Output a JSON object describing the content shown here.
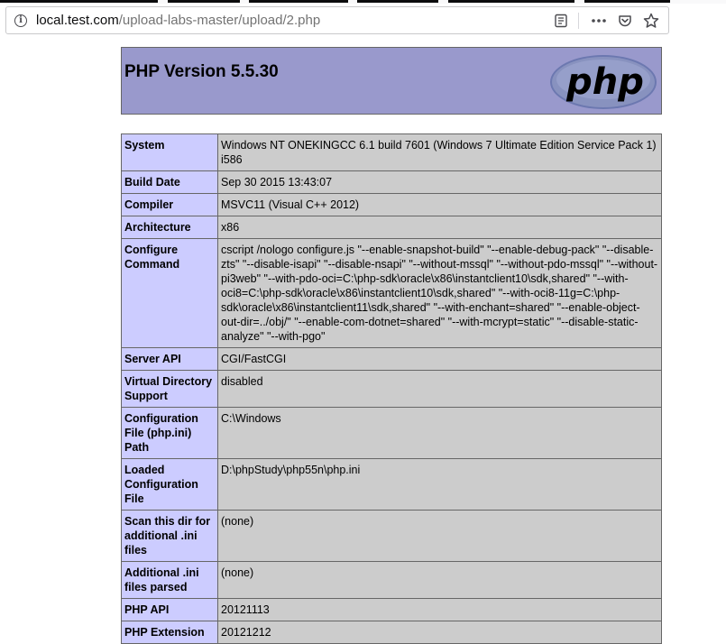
{
  "browser": {
    "url_host": "local.test.com",
    "url_path": "/upload-labs-master/upload/2.php",
    "icons": [
      "info-icon",
      "reader-view-icon",
      "more-icon",
      "pocket-icon",
      "bookmark-star-icon"
    ]
  },
  "header": {
    "title": "PHP Version 5.5.30",
    "logo_text": "php"
  },
  "colors": {
    "header_bg": "#9999cc",
    "label_bg": "#ccccff",
    "value_bg": "#cccccc",
    "border": "#666666"
  },
  "info_rows": [
    {
      "label": "System",
      "value": "Windows NT ONEKINGCC 6.1 build 7601 (Windows 7 Ultimate Edition Service Pack 1) i586"
    },
    {
      "label": "Build Date",
      "value": "Sep 30 2015 13:43:07"
    },
    {
      "label": "Compiler",
      "value": "MSVC11 (Visual C++ 2012)"
    },
    {
      "label": "Architecture",
      "value": "x86"
    },
    {
      "label": "Configure Command",
      "value": "cscript /nologo configure.js \"--enable-snapshot-build\" \"--enable-debug-pack\" \"--disable-zts\" \"--disable-isapi\" \"--disable-nsapi\" \"--without-mssql\" \"--without-pdo-mssql\" \"--without-pi3web\" \"--with-pdo-oci=C:\\php-sdk\\oracle\\x86\\instantclient10\\sdk,shared\" \"--with-oci8=C:\\php-sdk\\oracle\\x86\\instantclient10\\sdk,shared\" \"--with-oci8-11g=C:\\php-sdk\\oracle\\x86\\instantclient11\\sdk,shared\" \"--with-enchant=shared\" \"--enable-object-out-dir=../obj/\" \"--enable-com-dotnet=shared\" \"--with-mcrypt=static\" \"--disable-static-analyze\" \"--with-pgo\""
    },
    {
      "label": "Server API",
      "value": "CGI/FastCGI"
    },
    {
      "label": "Virtual Directory Support",
      "value": "disabled"
    },
    {
      "label": "Configuration File (php.ini) Path",
      "value": "C:\\Windows"
    },
    {
      "label": "Loaded Configuration File",
      "value": "D:\\phpStudy\\php55n\\php.ini"
    },
    {
      "label": "Scan this dir for additional .ini files",
      "value": "(none)"
    },
    {
      "label": "Additional .ini files parsed",
      "value": "(none)"
    },
    {
      "label": "PHP API",
      "value": "20121113"
    },
    {
      "label": "PHP Extension",
      "value": "20121212"
    }
  ]
}
